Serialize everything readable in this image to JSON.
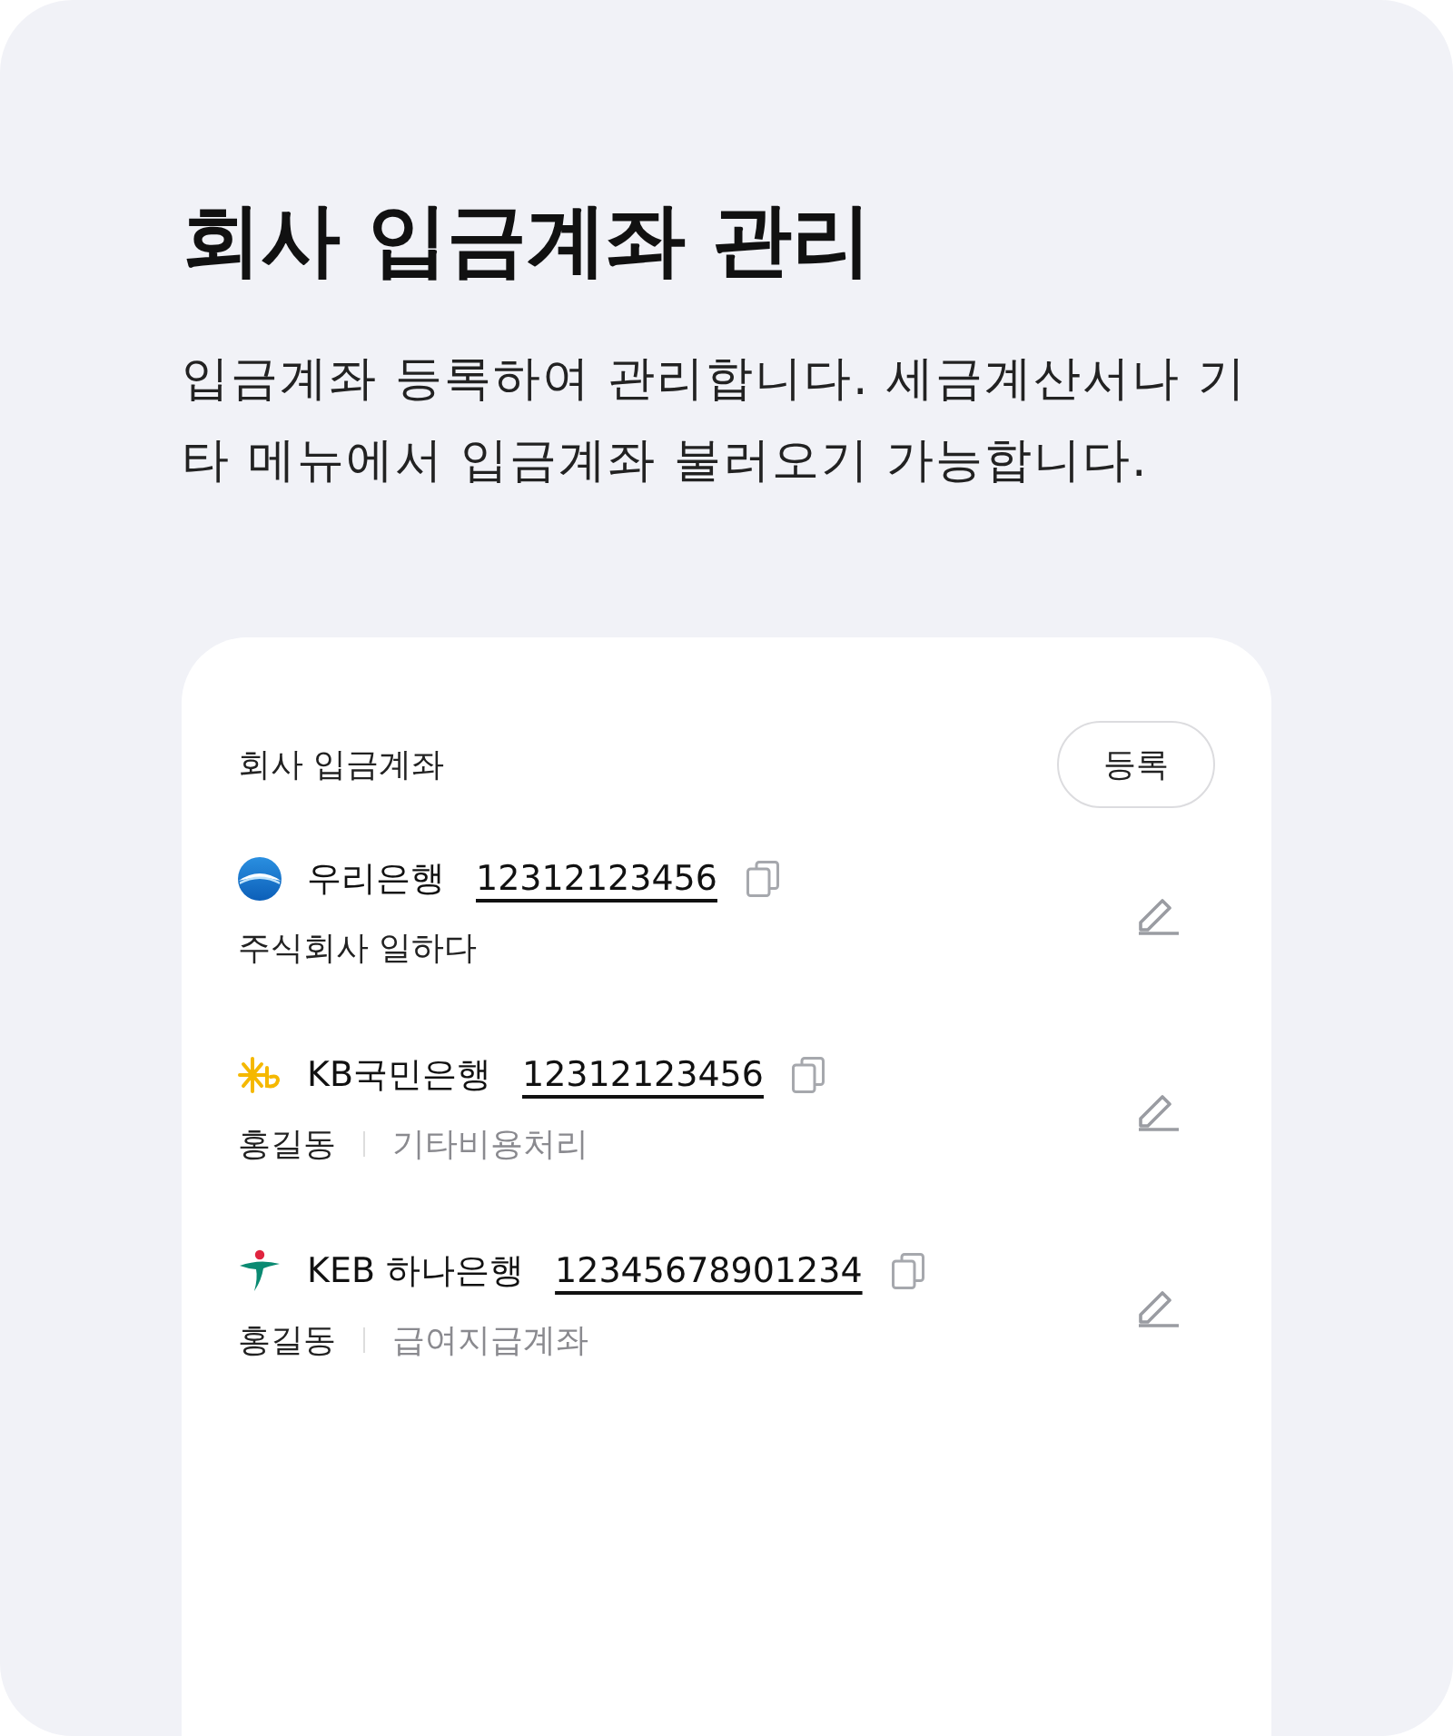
{
  "page": {
    "title": "회사 입금계좌 관리",
    "description": "입금계좌 등록하여 관리합니다. 세금계산서나 기타 메뉴에서 입금계좌 불러오기 가능합니다."
  },
  "card": {
    "title": "회사 입금계좌",
    "register_button": "등록",
    "accounts": [
      {
        "kind": "sphere",
        "bank": "우리은행",
        "number": "12312123456",
        "holder": "주식회사 일하다"
      },
      {
        "kind": "spark",
        "bank": "KB국민은행",
        "number": "12312123456",
        "holder": "홍길동",
        "memo": "기타비용처리"
      },
      {
        "kind": "figure",
        "bank": "KEB 하나은행",
        "number": "12345678901234",
        "holder": "홍길동",
        "memo": "급여지급계좌"
      }
    ]
  }
}
